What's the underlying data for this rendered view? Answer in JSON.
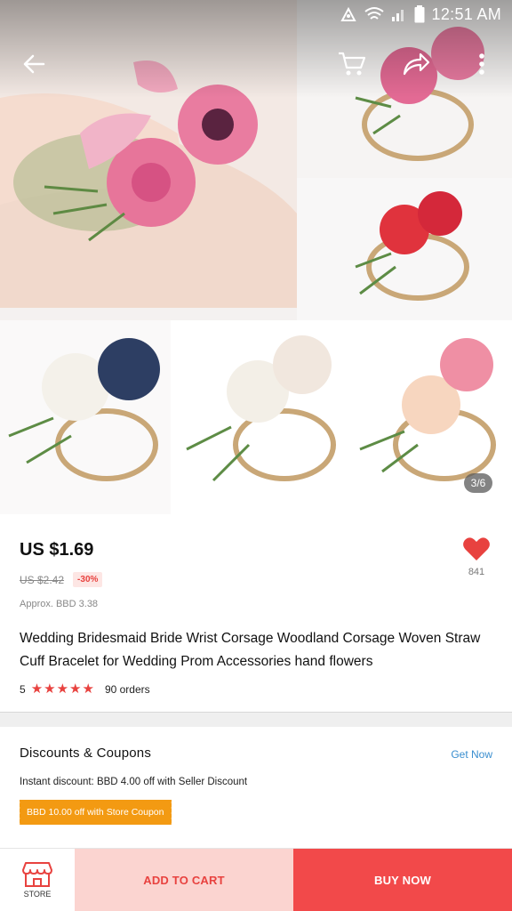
{
  "status_bar": {
    "time": "12:51 AM",
    "icons": [
      "nfc-icon",
      "wifi-icon",
      "signal-icon",
      "battery-icon"
    ]
  },
  "header": {
    "back_icon": "arrow-left-icon",
    "cart_icon": "cart-icon",
    "share_icon": "share-icon",
    "more_icon": "more-vertical-icon"
  },
  "gallery": {
    "indicator": "3/6"
  },
  "product": {
    "price": "US $1.69",
    "original_price": "US $2.42",
    "discount": "-30%",
    "approx_price": "Approx. BBD 3.38",
    "title": "Wedding Bridesmaid Bride Wrist Corsage Woodland Corsage Woven Straw Cuff Bracelet for Wedding Prom Accessories hand flowers",
    "rating": "5",
    "rating_stars": 5,
    "orders": "90 orders",
    "wishlist_count": "841"
  },
  "discounts": {
    "title": "Discounts & Coupons",
    "get_now": "Get Now",
    "instant": "Instant discount: BBD 4.00 off with Seller Discount",
    "coupon": "BBD 10.00 off with Store Coupon"
  },
  "bottom_bar": {
    "store_label": "STORE",
    "add_to_cart": "ADD TO CART",
    "buy_now": "BUY NOW"
  },
  "colors": {
    "accent": "#e8423f",
    "buy_now_bg": "#f2494a",
    "cart_bg": "#fbd4d0",
    "coupon_bg": "#f39a12",
    "link": "#3a8ecf"
  }
}
